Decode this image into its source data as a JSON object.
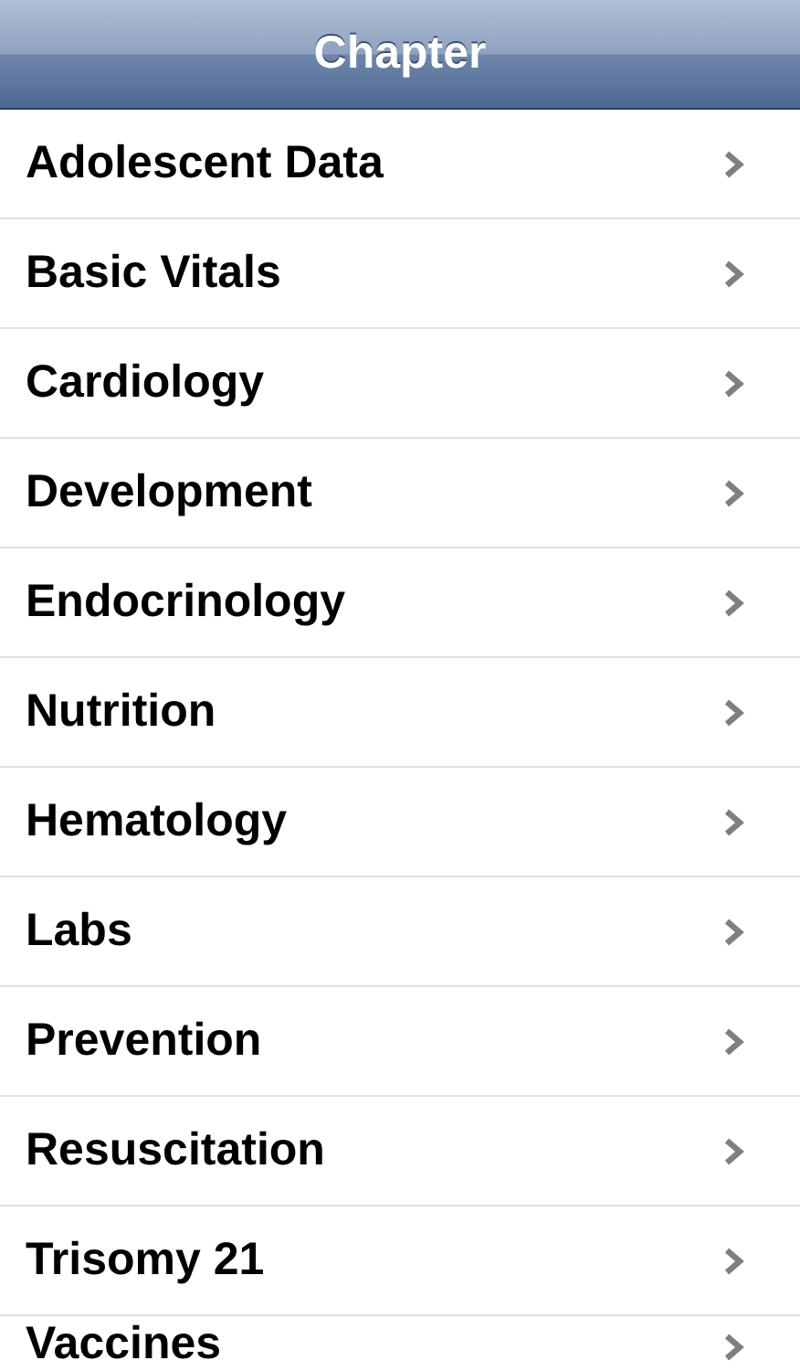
{
  "navbar": {
    "title": "Chapter"
  },
  "chapters": [
    {
      "label": "Adolescent Data"
    },
    {
      "label": "Basic Vitals"
    },
    {
      "label": "Cardiology"
    },
    {
      "label": "Development"
    },
    {
      "label": "Endocrinology"
    },
    {
      "label": "Nutrition"
    },
    {
      "label": "Hematology"
    },
    {
      "label": "Labs"
    },
    {
      "label": "Prevention"
    },
    {
      "label": "Resuscitation"
    },
    {
      "label": "Trisomy 21"
    },
    {
      "label": "Vaccines"
    }
  ]
}
